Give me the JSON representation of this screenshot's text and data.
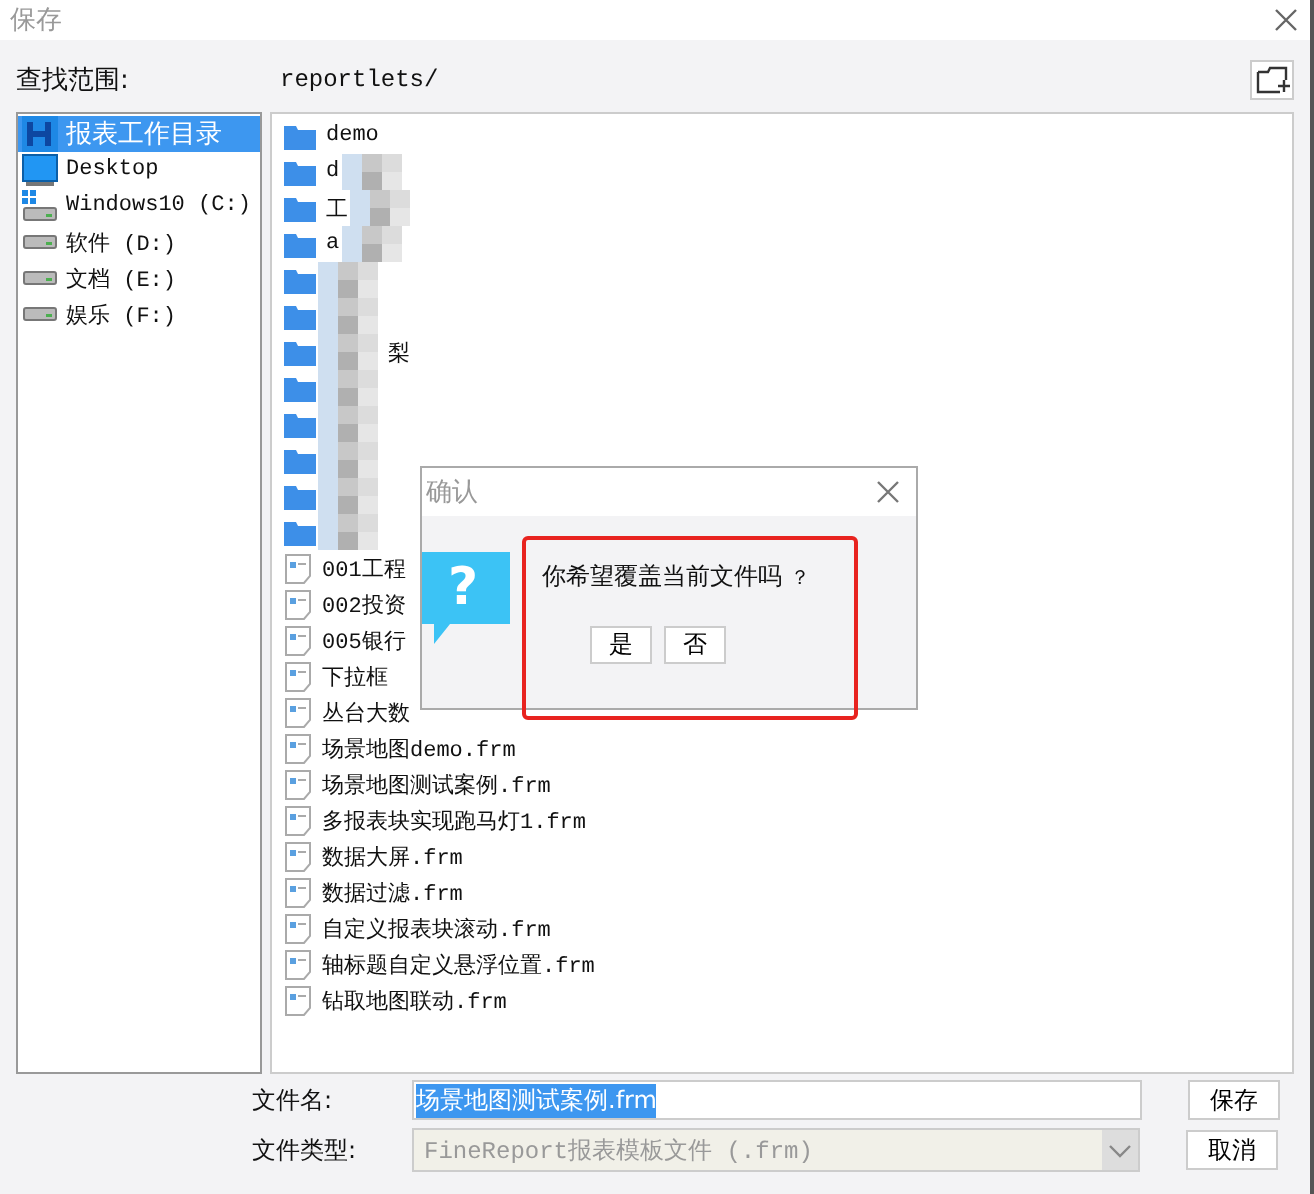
{
  "window": {
    "title": "保存"
  },
  "location": {
    "label": "查找范围:",
    "path": "reportlets/"
  },
  "sidebar": {
    "items": [
      {
        "label": "报表工作目录",
        "kind": "workdir",
        "selected": true
      },
      {
        "label": "Desktop",
        "kind": "desktop",
        "selected": false
      },
      {
        "label": "Windows10 (C:)",
        "kind": "system",
        "selected": false
      },
      {
        "label": "软件 (D:)",
        "kind": "drive",
        "selected": false
      },
      {
        "label": "文档 (E:)",
        "kind": "drive",
        "selected": false
      },
      {
        "label": "娱乐 (F:)",
        "kind": "drive",
        "selected": false
      }
    ]
  },
  "files": [
    {
      "kind": "folder",
      "name": "demo",
      "masked": false
    },
    {
      "kind": "folder",
      "name": "d",
      "masked": true
    },
    {
      "kind": "folder",
      "name": "工",
      "masked": true
    },
    {
      "kind": "folder",
      "name": "a",
      "masked": true
    },
    {
      "kind": "folder",
      "masked": true
    },
    {
      "kind": "folder",
      "masked": true
    },
    {
      "kind": "folder",
      "name_end": "梨",
      "masked": true
    },
    {
      "kind": "folder",
      "masked": true
    },
    {
      "kind": "folder",
      "masked": true
    },
    {
      "kind": "folder",
      "masked": true
    },
    {
      "kind": "folder",
      "masked": true
    },
    {
      "kind": "folder",
      "masked": true
    },
    {
      "kind": "file",
      "name": "001工程",
      "masked": false
    },
    {
      "kind": "file",
      "name": "002投资",
      "masked": false
    },
    {
      "kind": "file",
      "name": "005银行",
      "masked": false
    },
    {
      "kind": "file",
      "name": "下拉框",
      "masked": false
    },
    {
      "kind": "file",
      "name": "丛台大数",
      "masked": false
    },
    {
      "kind": "file",
      "name": "场景地图demo.frm",
      "masked": false
    },
    {
      "kind": "file",
      "name": "场景地图测试案例.frm",
      "masked": false
    },
    {
      "kind": "file",
      "name": "多报表块实现跑马灯1.frm",
      "masked": false
    },
    {
      "kind": "file",
      "name": "数据大屏.frm",
      "masked": false
    },
    {
      "kind": "file",
      "name": "数据过滤.frm",
      "masked": false
    },
    {
      "kind": "file",
      "name": "自定义报表块滚动.frm",
      "masked": false
    },
    {
      "kind": "file",
      "name": "轴标题自定义悬浮位置.frm",
      "masked": false
    },
    {
      "kind": "file",
      "name": "钻取地图联动.frm",
      "masked": false
    }
  ],
  "filename": {
    "label": "文件名:",
    "value": "场景地图测试案例.frm"
  },
  "filetype": {
    "label": "文件类型:",
    "value": "FineReport报表模板文件 (.frm)",
    "disabled": true
  },
  "buttons": [
    "保存",
    "取消"
  ],
  "dialog": {
    "title": "确认",
    "icon_glyph": "?",
    "message": "你希望覆盖当前文件吗",
    "mark": "？",
    "buttons": [
      "是",
      "否"
    ],
    "highlighted": true
  }
}
